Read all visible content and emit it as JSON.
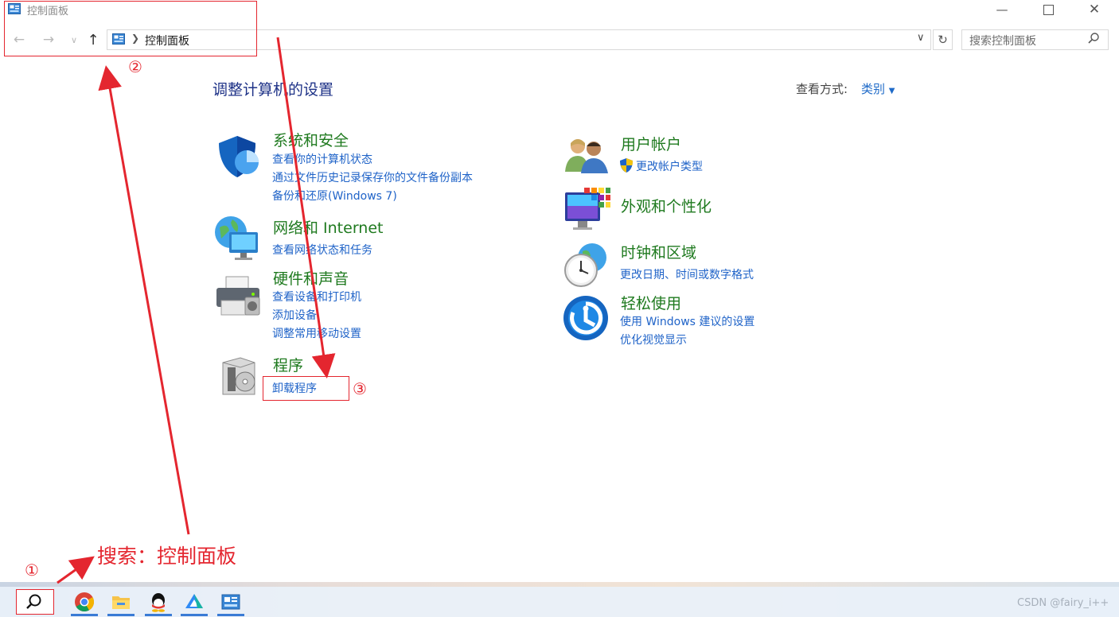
{
  "window": {
    "title": "控制面板"
  },
  "address": {
    "path_item": "控制面板",
    "search_placeholder": "搜索控制面板"
  },
  "content": {
    "heading": "调整计算机的设置",
    "view_by_label": "查看方式:",
    "view_by_value": "类别",
    "categories": [
      {
        "title": "系统和安全",
        "links": [
          "查看你的计算机状态",
          "通过文件历史记录保存你的文件备份副本",
          "备份和还原(Windows 7)"
        ]
      },
      {
        "title": "网络和 Internet",
        "links": [
          "查看网络状态和任务"
        ]
      },
      {
        "title": "硬件和声音",
        "links": [
          "查看设备和打印机",
          "添加设备",
          "调整常用移动设置"
        ]
      },
      {
        "title": "程序",
        "links": [
          "卸载程序"
        ]
      },
      {
        "title": "用户帐户",
        "links": [
          "更改帐户类型"
        ]
      },
      {
        "title": "外观和个性化",
        "links": []
      },
      {
        "title": "时钟和区域",
        "links": [
          "更改日期、时间或数字格式"
        ]
      },
      {
        "title": "轻松使用",
        "links": [
          "使用 Windows 建议的设置",
          "优化视觉显示"
        ]
      }
    ]
  },
  "annotations": {
    "step1": "①",
    "step2": "②",
    "step3": "③",
    "caption": "搜索：控制面板",
    "color": "#e4262f"
  },
  "taskbar": {
    "icons": [
      "search-icon",
      "chrome-icon",
      "file-explorer-icon",
      "qq-icon",
      "cloud-drive-icon",
      "control-panel-icon"
    ],
    "watermark": "CSDN @fairy_i++"
  }
}
